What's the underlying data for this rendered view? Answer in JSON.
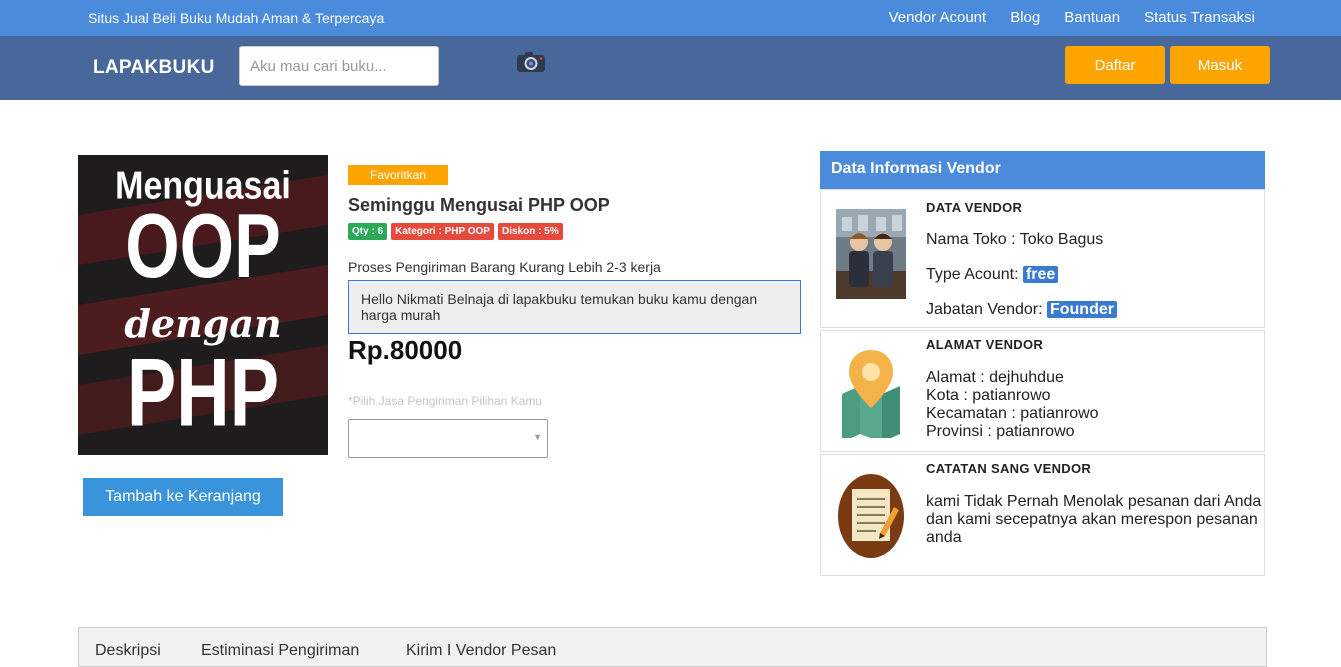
{
  "topbar": {
    "tagline": "Situs Jual Beli Buku Mudah Aman & Terpercaya",
    "links": [
      "Vendor Acount",
      "Blog",
      "Bantuan",
      "Status Transaksi"
    ],
    "color": "#4a8bdc"
  },
  "navbar": {
    "brand": "LAPAKBUKU",
    "search_placeholder": "Aku mau cari buku...",
    "camera_icon": "camera-icon",
    "register_label": "Daftar",
    "login_label": "Masuk",
    "color": "#48689c",
    "button_color": "#fda400"
  },
  "product": {
    "cover": {
      "line1": "Menguasai",
      "line2": "OOP",
      "line3": "dengan",
      "line4": "PHP"
    },
    "favorite_label": "Favoritkan",
    "title": "Seminggu Mengusai PHP OOP",
    "badges": {
      "qty": "Qty : 6",
      "category": "Kategori : PHP OOP",
      "discount": "Diskon : 5%"
    },
    "shipping_note": "Proses Pengiriman Barang Kurang Lebih 2-3 kerja",
    "message": "Hello Nikmati Belnaja di lapakbuku temukan buku kamu dengan harga murah",
    "price": "Rp.80000",
    "shipping_label": "*Pilih Jasa Pengiriman Pilihan Kamu",
    "shipping_selected": "",
    "cart_label": "Tambah ke Keranjang"
  },
  "vendor": {
    "header": "Data Informasi Vendor",
    "data": {
      "title": "DATA VENDOR",
      "shop_label": "Nama Toko : ",
      "shop_value": "Toko Bagus",
      "type_label": "Type Acount: ",
      "type_value": "free",
      "role_label": "Jabatan Vendor: ",
      "role_value": "Founder"
    },
    "address": {
      "title": "ALAMAT VENDOR",
      "alamat": "Alamat : dejhuhdue",
      "kota": "Kota : patianrowo",
      "kecamatan": "Kecamatan : patianrowo",
      "provinsi": "Provinsi : patianrowo"
    },
    "notes": {
      "title": "CATATAN SANG VENDOR",
      "text": "kami Tidak Pernah Menolak pesanan dari Anda dan kami secepatnya akan merespon pesanan anda"
    }
  },
  "tabs": [
    "Deskripsi",
    "Estiminasi Pengiriman",
    "Kirim I Vendor Pesan"
  ]
}
